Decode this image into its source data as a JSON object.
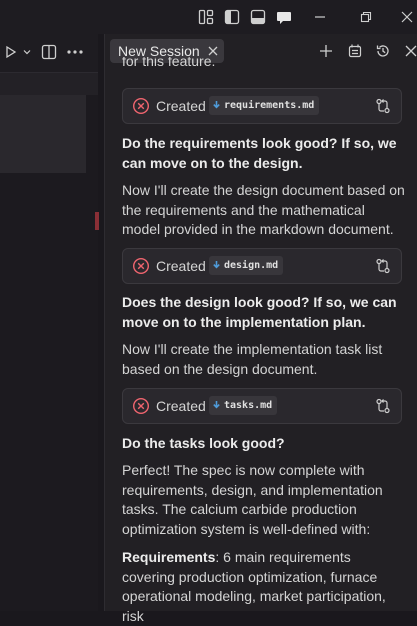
{
  "titlebar": {
    "icons": [
      "layout-customize-icon",
      "toggle-sidebar-icon",
      "toggle-panel-icon",
      "chat-icon"
    ],
    "window_controls": [
      "minimize-icon",
      "restore-icon",
      "close-icon"
    ]
  },
  "editor": {
    "toolbar_icons": [
      "run-icon",
      "chevron-down-icon",
      "split-editor-icon",
      "more-icon"
    ]
  },
  "chat": {
    "tab_label": "New Session",
    "header_icons": [
      "new-session-icon",
      "history-list-icon",
      "history-icon",
      "close-panel-icon"
    ],
    "cut_text": "for this feature.",
    "cards": [
      {
        "status": "Created",
        "file": "requirements.md"
      },
      {
        "status": "Created",
        "file": "design.md"
      },
      {
        "status": "Created",
        "file": "tasks.md"
      }
    ],
    "q1": "Do the requirements look good? If so, we can move on to the design.",
    "p1": "Now I'll create the design document based on the requirements and the mathematical model provided in the markdown document.",
    "q2": "Does the design look good? If so, we can move on to the implementation plan.",
    "p2": "Now I'll create the implementation task list based on the design document.",
    "q3": "Do the tasks look good?",
    "p3": "Perfect! The spec is now complete with requirements, design, and implementation tasks. The calcium carbide production optimization system is well-defined with:",
    "req_label": "Requirements",
    "req_text": ": 6 main requirements covering production optimization, furnace operational modeling, market participation, risk"
  },
  "colors": {
    "error_red": "#f0656f",
    "accent_blue": "#4f9bd9",
    "bg": "#222024"
  }
}
